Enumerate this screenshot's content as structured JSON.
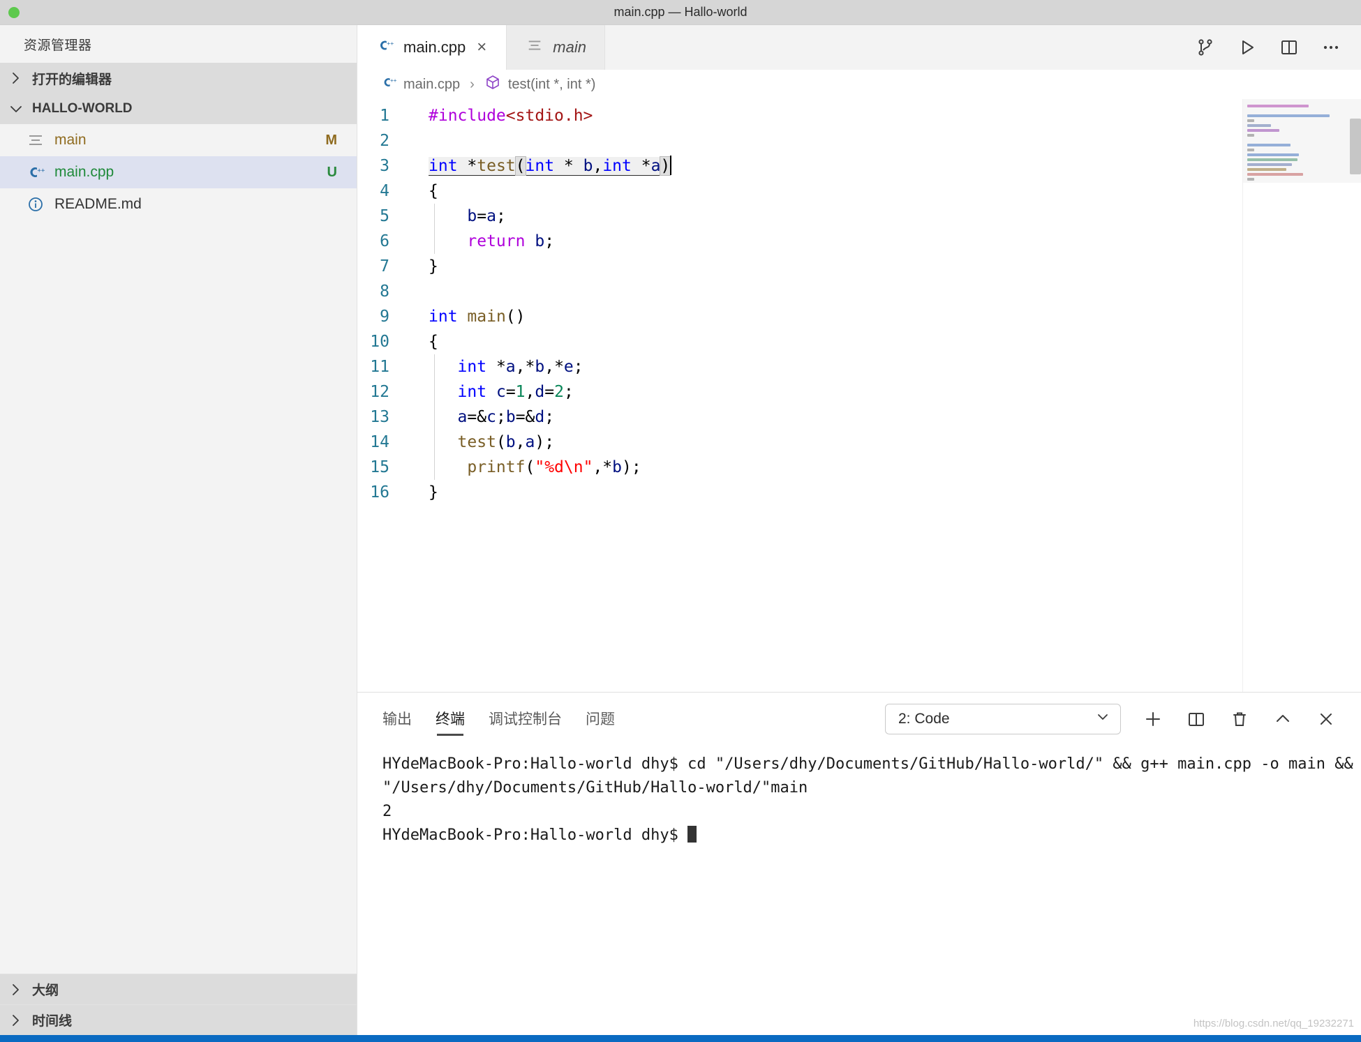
{
  "window": {
    "title": "main.cpp — Hallo-world",
    "traffic_lights": [
      "close-green"
    ]
  },
  "sidebar": {
    "title": "资源管理器",
    "sections": [
      {
        "label": "打开的编辑器",
        "expanded": false,
        "icon": "chevron-right-icon"
      },
      {
        "label": "HALLO-WORLD",
        "expanded": true,
        "icon": "chevron-down-icon"
      }
    ],
    "files": [
      {
        "name": "main",
        "icon": "binary-file-icon",
        "badge": "M",
        "badge_color": "#8f6b1f",
        "name_color": "#8f6b1f",
        "selected": false
      },
      {
        "name": "main.cpp",
        "icon": "cpp-file-icon",
        "badge": "U",
        "badge_color": "#2a8a3e",
        "name_color": "#1f8a3a",
        "selected": true
      },
      {
        "name": "README.md",
        "icon": "info-file-icon",
        "badge": "",
        "badge_color": "#333",
        "name_color": "#333333",
        "selected": false
      }
    ],
    "bottom_sections": [
      {
        "label": "大纲",
        "icon": "chevron-right-icon"
      },
      {
        "label": "时间线",
        "icon": "chevron-right-icon"
      }
    ]
  },
  "tabs": [
    {
      "label": "main.cpp",
      "icon": "cpp-file-icon",
      "active": true,
      "preview": false,
      "close": "×"
    },
    {
      "label": "main",
      "icon": "binary-file-icon",
      "active": false,
      "preview": true,
      "close": ""
    }
  ],
  "editor_actions": [
    {
      "name": "split-source-control-icon",
      "title": ""
    },
    {
      "name": "run-play-icon",
      "title": ""
    },
    {
      "name": "split-editor-icon",
      "title": ""
    },
    {
      "name": "more-actions-icon",
      "title": "…"
    }
  ],
  "breadcrumb": [
    {
      "label": "main.cpp",
      "icon": "cpp-file-icon"
    },
    {
      "label": "test(int *, int *)",
      "icon": "symbol-method-icon"
    }
  ],
  "breadcrumb_separator": "›",
  "code": {
    "language": "cpp",
    "cursor_line": 3,
    "lines": [
      {
        "n": "1",
        "tokens": [
          {
            "t": "#include",
            "c": "pp"
          },
          {
            "t": "<stdio.h>",
            "c": "inc"
          }
        ]
      },
      {
        "n": "2",
        "tokens": []
      },
      {
        "n": "3",
        "tokens": [
          {
            "t": "int",
            "c": "k"
          },
          {
            "t": " *",
            "c": "pn"
          },
          {
            "t": "test",
            "c": "fn"
          },
          {
            "t": "(",
            "c": "brk"
          },
          {
            "t": "int",
            "c": "k"
          },
          {
            "t": " * ",
            "c": "pn"
          },
          {
            "t": "b",
            "c": "var"
          },
          {
            "t": ",",
            "c": "pn"
          },
          {
            "t": "int",
            "c": "k"
          },
          {
            "t": " *",
            "c": "pn"
          },
          {
            "t": "a",
            "c": "var"
          },
          {
            "t": ")",
            "c": "brk"
          }
        ]
      },
      {
        "n": "4",
        "tokens": [
          {
            "t": "{",
            "c": "pn"
          }
        ]
      },
      {
        "n": "5",
        "tokens": [
          {
            "t": "    ",
            "c": "pn"
          },
          {
            "t": "b",
            "c": "var"
          },
          {
            "t": "=",
            "c": "pn"
          },
          {
            "t": "a",
            "c": "var"
          },
          {
            "t": ";",
            "c": "pn"
          }
        ],
        "guide": true
      },
      {
        "n": "6",
        "tokens": [
          {
            "t": "    ",
            "c": "pn"
          },
          {
            "t": "return",
            "c": "ret"
          },
          {
            "t": " ",
            "c": "pn"
          },
          {
            "t": "b",
            "c": "var"
          },
          {
            "t": ";",
            "c": "pn"
          }
        ],
        "guide": true
      },
      {
        "n": "7",
        "tokens": [
          {
            "t": "}",
            "c": "pn"
          }
        ]
      },
      {
        "n": "8",
        "tokens": []
      },
      {
        "n": "9",
        "tokens": [
          {
            "t": "int",
            "c": "k"
          },
          {
            "t": " ",
            "c": "pn"
          },
          {
            "t": "main",
            "c": "fn"
          },
          {
            "t": "()",
            "c": "pn"
          }
        ]
      },
      {
        "n": "10",
        "tokens": [
          {
            "t": "{",
            "c": "pn"
          }
        ]
      },
      {
        "n": "11",
        "tokens": [
          {
            "t": "   ",
            "c": "pn"
          },
          {
            "t": "int",
            "c": "k"
          },
          {
            "t": " *",
            "c": "pn"
          },
          {
            "t": "a",
            "c": "var"
          },
          {
            "t": ",*",
            "c": "pn"
          },
          {
            "t": "b",
            "c": "var"
          },
          {
            "t": ",*",
            "c": "pn"
          },
          {
            "t": "e",
            "c": "var"
          },
          {
            "t": ";",
            "c": "pn"
          }
        ],
        "guide": true
      },
      {
        "n": "12",
        "tokens": [
          {
            "t": "   ",
            "c": "pn"
          },
          {
            "t": "int",
            "c": "k"
          },
          {
            "t": " ",
            "c": "pn"
          },
          {
            "t": "c",
            "c": "var"
          },
          {
            "t": "=",
            "c": "pn"
          },
          {
            "t": "1",
            "c": "num"
          },
          {
            "t": ",",
            "c": "pn"
          },
          {
            "t": "d",
            "c": "var"
          },
          {
            "t": "=",
            "c": "pn"
          },
          {
            "t": "2",
            "c": "num"
          },
          {
            "t": ";",
            "c": "pn"
          }
        ],
        "guide": true
      },
      {
        "n": "13",
        "tokens": [
          {
            "t": "   ",
            "c": "pn"
          },
          {
            "t": "a",
            "c": "var"
          },
          {
            "t": "=&",
            "c": "pn"
          },
          {
            "t": "c",
            "c": "var"
          },
          {
            "t": ";",
            "c": "pn"
          },
          {
            "t": "b",
            "c": "var"
          },
          {
            "t": "=&",
            "c": "pn"
          },
          {
            "t": "d",
            "c": "var"
          },
          {
            "t": ";",
            "c": "pn"
          }
        ],
        "guide": true
      },
      {
        "n": "14",
        "tokens": [
          {
            "t": "   ",
            "c": "pn"
          },
          {
            "t": "test",
            "c": "fn"
          },
          {
            "t": "(",
            "c": "pn"
          },
          {
            "t": "b",
            "c": "var"
          },
          {
            "t": ",",
            "c": "pn"
          },
          {
            "t": "a",
            "c": "var"
          },
          {
            "t": ");",
            "c": "pn"
          }
        ],
        "guide": true
      },
      {
        "n": "15",
        "tokens": [
          {
            "t": "    ",
            "c": "pn"
          },
          {
            "t": "printf",
            "c": "fn"
          },
          {
            "t": "(",
            "c": "pn"
          },
          {
            "t": "\"%d\\n\"",
            "c": "str"
          },
          {
            "t": ",*",
            "c": "pn"
          },
          {
            "t": "b",
            "c": "var"
          },
          {
            "t": ");",
            "c": "pn"
          }
        ],
        "guide": true
      },
      {
        "n": "16",
        "tokens": [
          {
            "t": "}",
            "c": "pn"
          }
        ]
      }
    ]
  },
  "panel": {
    "tabs": [
      {
        "label": "输出",
        "active": false
      },
      {
        "label": "终端",
        "active": true
      },
      {
        "label": "调试控制台",
        "active": false
      },
      {
        "label": "问题",
        "active": false
      }
    ],
    "terminal_select": {
      "value": "2: Code",
      "chevron": "chevron-down-icon"
    },
    "actions": [
      {
        "name": "new-terminal-icon",
        "glyph": "+"
      },
      {
        "name": "split-terminal-icon",
        "glyph": ""
      },
      {
        "name": "kill-terminal-icon",
        "glyph": ""
      },
      {
        "name": "maximize-panel-icon",
        "glyph": ""
      },
      {
        "name": "close-panel-icon",
        "glyph": ""
      }
    ],
    "terminal_lines": [
      "HYdeMacBook-Pro:Hallo-world dhy$ cd \"/Users/dhy/Documents/GitHub/Hallo-world/\" && g++ main.cpp -o main && \"/Users/dhy/Documents/GitHub/Hallo-world/\"main",
      "2",
      "HYdeMacBook-Pro:Hallo-world dhy$ "
    ]
  },
  "watermark": "https://blog.csdn.net/qq_19232271",
  "colors": {
    "accent": "#0a6ac1",
    "selection": "#dde1f0",
    "sidebar_bg": "#f3f3f3",
    "titlebar_bg": "#d6d6d6"
  }
}
